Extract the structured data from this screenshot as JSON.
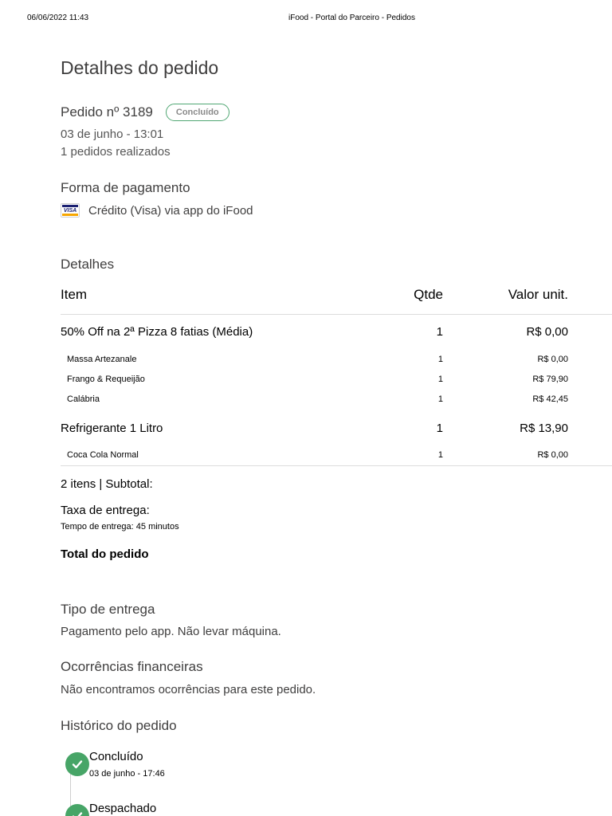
{
  "print_header": {
    "datetime": "06/06/2022 11:43",
    "title": "iFood - Portal do Parceiro - Pedidos"
  },
  "page_title": "Detalhes do pedido",
  "order": {
    "number_label": "Pedido nº 3189",
    "status": "Concluído",
    "date": "03 de junho - 13:01",
    "count": "1 pedidos realizados"
  },
  "payment": {
    "title": "Forma de pagamento",
    "card_icon": "visa-card-icon",
    "card_brand_text": "VISA",
    "method": "Crédito (Visa) via app do iFood"
  },
  "details": {
    "title": "Detalhes",
    "headers": {
      "item": "Item",
      "qty": "Qtde",
      "price": "Valor unit."
    },
    "items": [
      {
        "name": "50% Off na 2ª Pizza 8 fatias (Média)",
        "qty": "1",
        "price": "R$ 0,00",
        "sub": [
          {
            "name": "Massa Artezanale",
            "qty": "1",
            "price": "R$ 0,00"
          },
          {
            "name": "Frango & Requeijão",
            "qty": "1",
            "price": "R$ 79,90"
          },
          {
            "name": "Calábria",
            "qty": "1",
            "price": "R$ 42,45"
          }
        ]
      },
      {
        "name": "Refrigerante 1 Litro",
        "qty": "1",
        "price": "R$ 13,90",
        "sub": [
          {
            "name": "Coca Cola Normal",
            "qty": "1",
            "price": "R$ 0,00"
          }
        ]
      }
    ],
    "subtotal_label": "2 itens | Subtotal:",
    "delivery_fee_label": "Taxa de entrega:",
    "delivery_time": "Tempo de entrega: 45 minutos",
    "total_label": "Total do pedido"
  },
  "delivery_type": {
    "title": "Tipo de entrega",
    "text": "Pagamento pelo app. Não levar máquina."
  },
  "financial": {
    "title": "Ocorrências financeiras",
    "text": "Não encontramos ocorrências para este pedido."
  },
  "history": {
    "title": "Histórico do pedido",
    "events": [
      {
        "label": "Concluído",
        "time": "03 de junho - 17:46"
      },
      {
        "label": "Despachado",
        "time": ""
      }
    ]
  },
  "colors": {
    "status_green": "#47a567",
    "badge_border": "#50a773",
    "text_primary": "#3f3e3e"
  }
}
